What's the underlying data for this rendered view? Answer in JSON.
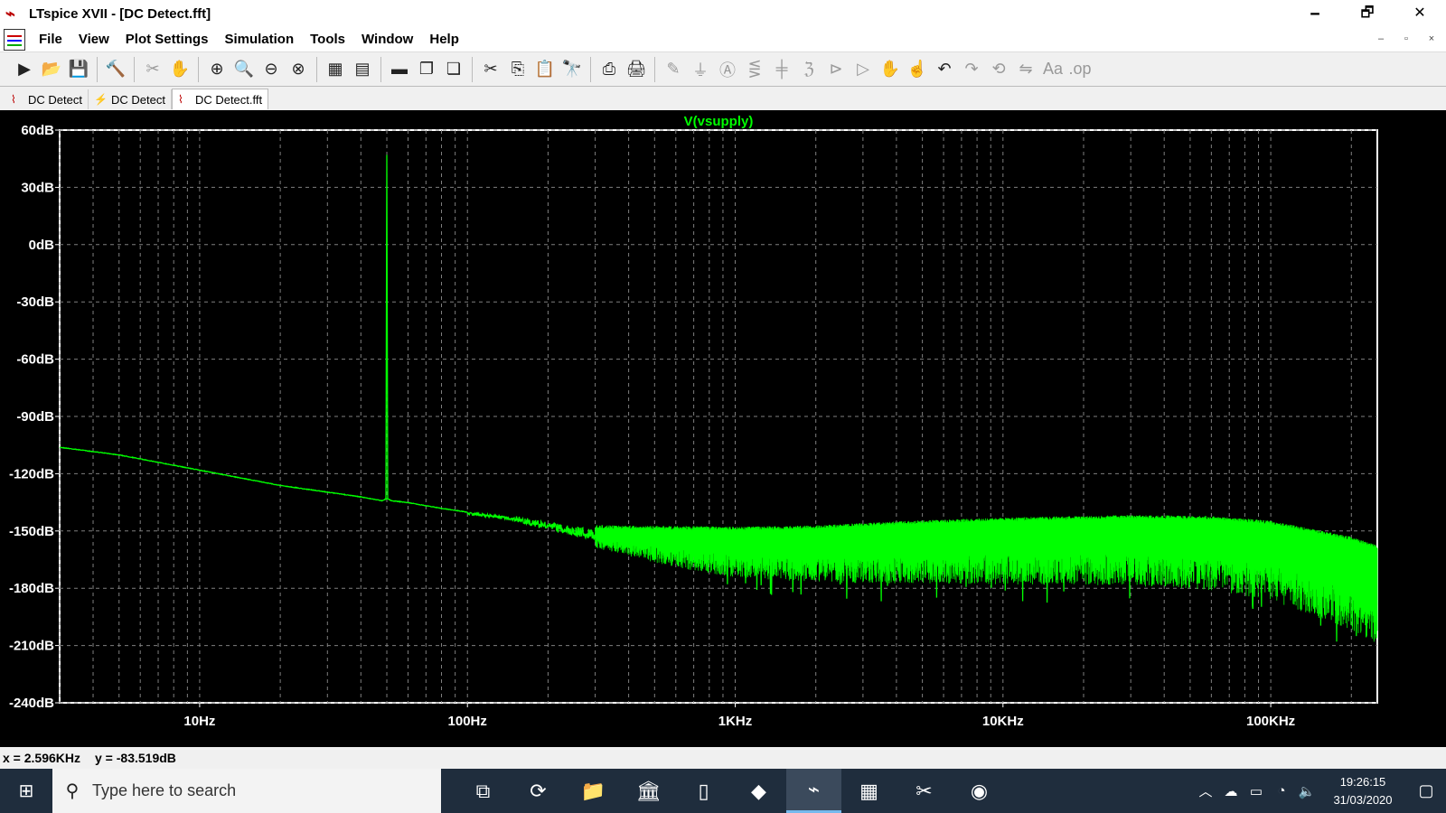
{
  "window": {
    "title": "LTspice XVII - [DC Detect.fft]",
    "buttons": [
      "🗕",
      "🗗",
      "✕"
    ]
  },
  "menu": {
    "items": [
      "File",
      "View",
      "Plot Settings",
      "Simulation",
      "Tools",
      "Window",
      "Help"
    ],
    "mdi_buttons": [
      "–",
      "▫",
      "×"
    ]
  },
  "toolbar": {
    "groups": [
      [
        "new-schematic-icon",
        "open-folder-icon",
        "save-icon"
      ],
      [
        "control-panel-icon"
      ],
      [
        "run-icon",
        "halt-hand-icon"
      ],
      [
        "zoom-in-icon",
        "zoom-area-icon",
        "zoom-out-icon",
        "zoom-fit-icon"
      ],
      [
        "autorange-icon",
        "plot-settings-icon"
      ],
      [
        "tile-horizontal-icon",
        "cascade-icon",
        "tile-vertical-icon"
      ],
      [
        "cut-icon",
        "copy-icon",
        "paste-icon",
        "find-icon"
      ],
      [
        "print-icon",
        "print-setup-icon"
      ],
      [
        "wire-icon",
        "ground-icon",
        "label-icon",
        "resistor-icon",
        "capacitor-icon",
        "inductor-icon",
        "diode-icon",
        "component-icon",
        "move-icon",
        "drag-icon",
        "undo-icon",
        "redo-icon",
        "rotate-icon",
        "mirror-icon",
        "text-icon",
        "spice-directive-icon"
      ]
    ]
  },
  "tabs": [
    {
      "label": "DC Detect",
      "icon": "waveform-icon",
      "active": false
    },
    {
      "label": "DC Detect",
      "icon": "schematic-icon",
      "active": false
    },
    {
      "label": "DC Detect.fft",
      "icon": "waveform-icon",
      "active": true
    }
  ],
  "chart_data": {
    "type": "line",
    "title": "V(vsupply)",
    "x_scale": "log",
    "xlim_hz": [
      3,
      250000
    ],
    "ylim_db": [
      -240,
      60
    ],
    "y_ticks": [
      {
        "value": 60,
        "label": "60dB"
      },
      {
        "value": 30,
        "label": "30dB"
      },
      {
        "value": 0,
        "label": "0dB"
      },
      {
        "value": -30,
        "label": "-30dB"
      },
      {
        "value": -60,
        "label": "-60dB"
      },
      {
        "value": -90,
        "label": "-90dB"
      },
      {
        "value": -120,
        "label": "-120dB"
      },
      {
        "value": -150,
        "label": "-150dB"
      },
      {
        "value": -180,
        "label": "-180dB"
      },
      {
        "value": -210,
        "label": "-210dB"
      },
      {
        "value": -240,
        "label": "-240dB"
      }
    ],
    "x_ticks": [
      {
        "value": 10,
        "label": "10Hz"
      },
      {
        "value": 100,
        "label": "100Hz"
      },
      {
        "value": 1000,
        "label": "1KHz"
      },
      {
        "value": 10000,
        "label": "10KHz"
      },
      {
        "value": 100000,
        "label": "100KHz"
      }
    ],
    "grid": true,
    "series": [
      {
        "name": "V(vsupply)",
        "color": "#00ff00",
        "points": [
          [
            3,
            -106
          ],
          [
            5,
            -110
          ],
          [
            10,
            -118
          ],
          [
            20,
            -126
          ],
          [
            40,
            -132
          ],
          [
            48,
            -134
          ],
          [
            49.5,
            -133
          ],
          [
            50,
            47
          ],
          [
            50.5,
            -133
          ],
          [
            52,
            -134
          ],
          [
            60,
            -135
          ],
          [
            80,
            -138
          ],
          [
            100,
            -140
          ],
          [
            150,
            -143
          ],
          [
            200,
            -147
          ],
          [
            300,
            -151
          ],
          [
            500,
            -153
          ],
          [
            1000,
            -155
          ],
          [
            2000,
            -155
          ],
          [
            5000,
            -153
          ],
          [
            10000,
            -152
          ],
          [
            30000,
            -151
          ],
          [
            60000,
            -152
          ],
          [
            100000,
            -155
          ],
          [
            200000,
            -165
          ],
          [
            250000,
            -170
          ]
        ],
        "noise_band": [
          [
            150,
            3
          ],
          [
            300,
            6
          ],
          [
            600,
            12
          ],
          [
            1000,
            15
          ],
          [
            3000,
            18
          ],
          [
            10000,
            20
          ],
          [
            50000,
            22
          ],
          [
            100000,
            24
          ],
          [
            250000,
            30
          ]
        ]
      }
    ]
  },
  "status": {
    "x_readout": "x = 2.596KHz",
    "y_readout": "y = -83.519dB"
  },
  "taskbar": {
    "search_placeholder": "Type here to search",
    "apps": [
      "task-view-icon",
      "sync-icon",
      "file-explorer-icon",
      "bank-icon",
      "blank-document-icon",
      "notepad-icon",
      "ltspice-icon",
      "calculator-icon",
      "snipping-icon",
      "edge-icon"
    ],
    "active_app": "ltspice-icon",
    "time": "19:26:15",
    "date": "31/03/2020"
  }
}
